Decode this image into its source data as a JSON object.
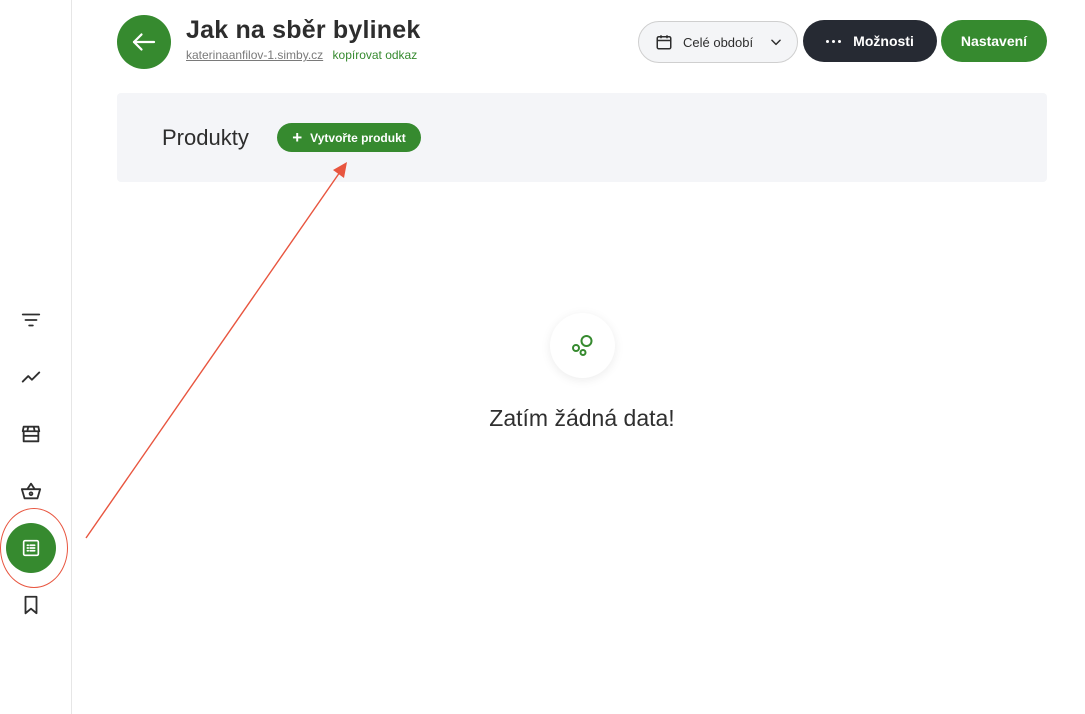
{
  "header": {
    "title": "Jak na sběr bylinek",
    "site_link": "katerinaanfilov-1.simby.cz",
    "copy_link": "kopírovat odkaz",
    "period_label": "Celé období",
    "options_label": "Možnosti",
    "settings_label": "Nastavení"
  },
  "sidebar": {
    "items": [
      {
        "icon": "filter-icon"
      },
      {
        "icon": "chart-line-icon"
      },
      {
        "icon": "store-icon"
      },
      {
        "icon": "basket-icon"
      },
      {
        "icon": "list-icon",
        "active": true
      },
      {
        "icon": "bookmark-icon"
      }
    ]
  },
  "products": {
    "title": "Produkty",
    "create_label": "Vytvořte produkt"
  },
  "empty_state": {
    "text": "Zatím žádná data!"
  },
  "colors": {
    "primary": "#368a2f",
    "dark": "#262a33",
    "panel": "#f4f5f8",
    "annotation": "#e8553f"
  }
}
